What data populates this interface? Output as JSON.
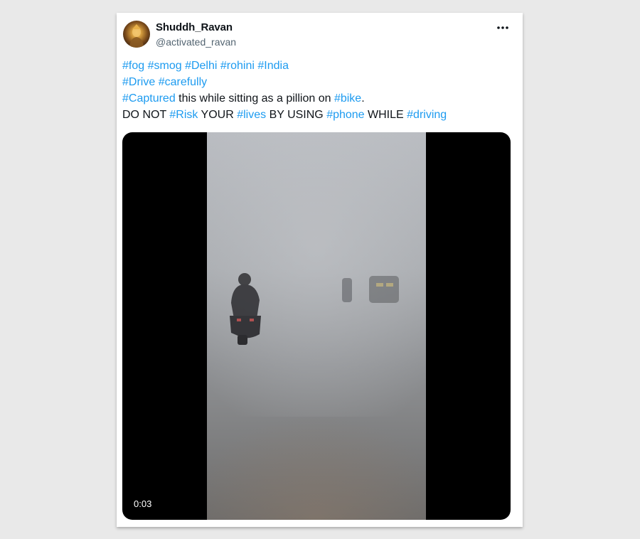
{
  "tweet": {
    "display_name": "Shuddh_Ravan",
    "handle": "@activated_ravan",
    "more_icon": "ellipsis-icon",
    "lines": [
      [
        {
          "text": "#fog",
          "tag": true
        },
        {
          "text": " ",
          "tag": false
        },
        {
          "text": "#smog",
          "tag": true
        },
        {
          "text": " ",
          "tag": false
        },
        {
          "text": "#Delhi",
          "tag": true
        },
        {
          "text": " ",
          "tag": false
        },
        {
          "text": "#rohini",
          "tag": true
        },
        {
          "text": " ",
          "tag": false
        },
        {
          "text": "#India",
          "tag": true
        }
      ],
      [
        {
          "text": "#Drive",
          "tag": true
        },
        {
          "text": " ",
          "tag": false
        },
        {
          "text": "#carefully",
          "tag": true
        }
      ],
      [
        {
          "text": "#Captured",
          "tag": true
        },
        {
          "text": " this while sitting as a pillion on ",
          "tag": false
        },
        {
          "text": "#bike",
          "tag": true
        },
        {
          "text": ".",
          "tag": false
        }
      ],
      [
        {
          "text": "DO NOT ",
          "tag": false
        },
        {
          "text": "#Risk",
          "tag": true
        },
        {
          "text": " YOUR ",
          "tag": false
        },
        {
          "text": "#lives",
          "tag": true
        },
        {
          "text": " BY USING ",
          "tag": false
        },
        {
          "text": "#phone",
          "tag": true
        },
        {
          "text": " WHILE ",
          "tag": false
        },
        {
          "text": "#driving",
          "tag": true
        }
      ]
    ]
  },
  "video": {
    "timestamp": "0:03"
  },
  "colors": {
    "hashtag": "#1d9bf0",
    "text": "#0f1419",
    "secondary": "#536471",
    "page_background": "#e9e9e9"
  }
}
